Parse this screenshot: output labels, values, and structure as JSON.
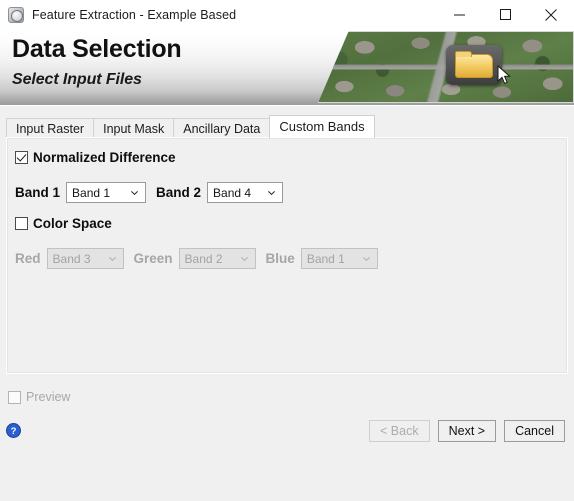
{
  "window": {
    "title": "Feature Extraction - Example Based",
    "app_icon": "app-circle-icon",
    "controls": {
      "minimize": "minimize-icon",
      "maximize": "maximize-icon",
      "close": "close-icon"
    }
  },
  "banner": {
    "title": "Data Selection",
    "subtitle": "Select Input Files",
    "image": "aerial-suburban-photo",
    "overlay_icon": "folder-icon",
    "cursor": "mouse-pointer-icon"
  },
  "tabs": [
    {
      "label": "Input Raster",
      "active": false
    },
    {
      "label": "Input Mask",
      "active": false
    },
    {
      "label": "Ancillary Data",
      "active": false
    },
    {
      "label": "Custom Bands",
      "active": true
    }
  ],
  "panel": {
    "normalized_difference": {
      "label": "Normalized Difference",
      "checked": true,
      "enabled": true,
      "fields": [
        {
          "label": "Band 1",
          "value": "Band 1"
        },
        {
          "label": "Band 2",
          "value": "Band 4"
        }
      ]
    },
    "color_space": {
      "label": "Color Space",
      "checked": false,
      "enabled": false,
      "fields": [
        {
          "label": "Red",
          "value": "Band 3"
        },
        {
          "label": "Green",
          "value": "Band 2"
        },
        {
          "label": "Blue",
          "value": "Band 1"
        }
      ]
    }
  },
  "footer": {
    "preview": {
      "label": "Preview",
      "checked": false,
      "enabled": false
    },
    "help_icon": "help-question-icon",
    "buttons": [
      {
        "label": "< Back",
        "enabled": false
      },
      {
        "label": "Next >",
        "enabled": true
      },
      {
        "label": "Cancel",
        "enabled": true
      }
    ]
  },
  "colors": {
    "accent": "#2b5fd0",
    "banner_gradient_top": "#ffffff",
    "banner_gradient_bottom": "#9b9b9b",
    "window_bg": "#f0f0f0"
  }
}
